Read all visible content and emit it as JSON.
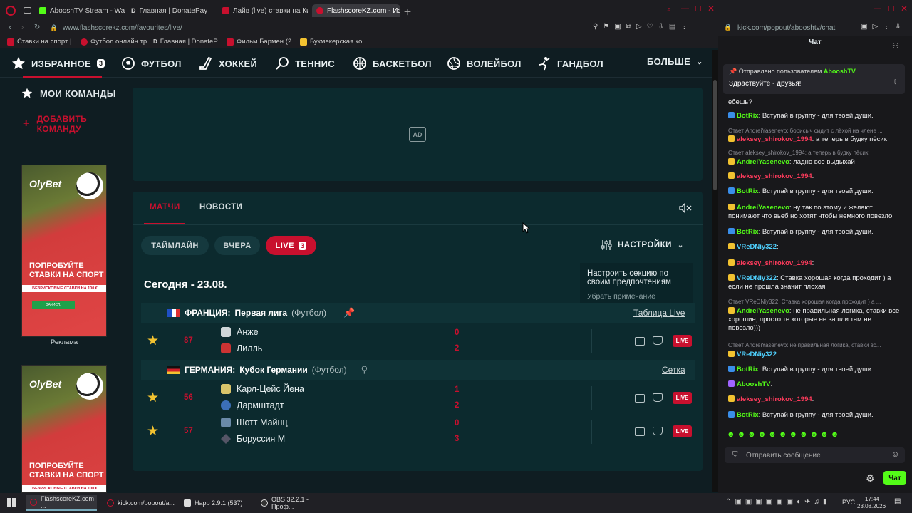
{
  "browser_tabs": [
    "AbooshTV Stream - Watch",
    "Главная | DonatePay",
    "Лайв (live) ставки на Киб",
    "FlashscoreKZ.com - Избра"
  ],
  "address": "www.flashscorekz.com/favourites/live/",
  "bookmarks": [
    "Ставки на спорт |...",
    "Футбол онлайн тр...",
    "Главная | DonateP...",
    "Фильм Бармен (2...",
    "Букмекерская ко..."
  ],
  "nav": {
    "favorites": "ИЗБРАННОЕ",
    "favorites_count": "3",
    "items": [
      "ФУТБОЛ",
      "ХОККЕЙ",
      "ТЕННИС",
      "БАСКЕТБОЛ",
      "ВОЛЕЙБОЛ",
      "ГАНДБОЛ"
    ],
    "more": "БОЛЬШЕ"
  },
  "sidebar": {
    "my_teams": "МОИ КОМАНДЫ",
    "add_team": [
      "ДОБАВИТЬ",
      "КОМАНДУ"
    ],
    "ad_label": "Реклама",
    "ad": {
      "brand": "OlyBet",
      "line1": "ПОПРОБУЙТЕ",
      "line2": "СТАВКИ НА СПОРТ",
      "sub": "БЕЗРИСКОВЫЕ СТАВКИ НА 100 €",
      "btn": "ЗАЧИСЛ."
    }
  },
  "ad_badge": "AD",
  "tabs": {
    "matches": "МАТЧИ",
    "news": "НОВОСТИ"
  },
  "filters": {
    "timeline": "ТАЙМЛАЙН",
    "yesterday": "ВЧЕРА",
    "live": "LIVE",
    "live_count": "3"
  },
  "settings": "НАСТРОЙКИ",
  "tooltip": {
    "text": "Настроить секцию по своим предпочтениям",
    "dismiss": "Убрать примечание"
  },
  "date_heading": "Сегодня - 23.08.",
  "leagues": [
    {
      "country": "ФРАНЦИЯ:",
      "name": "Первая лига",
      "sport": "(Футбол)",
      "link": "Таблица Live"
    },
    {
      "country": "ГЕРМАНИЯ:",
      "name": "Кубок Германии",
      "sport": "(Футбол)",
      "link": "Сетка"
    }
  ],
  "matches": [
    {
      "minute": "87",
      "home": "Анже",
      "away": "Лилль",
      "home_score": "0",
      "away_score": "2"
    },
    {
      "minute": "56",
      "home": "Карл-Цейс Йена",
      "away": "Дармштадт",
      "home_score": "1",
      "away_score": "2"
    },
    {
      "minute": "57",
      "home": "Шотт Майнц",
      "away": "Боруссия М",
      "home_score": "0",
      "away_score": "3"
    }
  ],
  "live_label": "LIVE",
  "chat": {
    "address": "kick.com/popout/abooshtv/chat",
    "title": "Чат",
    "pinned_by": "Отправлено пользователем",
    "pinned_user": "AbooshTV",
    "pinned_text": "Здраствуйте - друзья!",
    "messages": [
      {
        "type": "msg",
        "user": "",
        "text": "ебешь?"
      },
      {
        "type": "msg",
        "user": "BotRix",
        "text": ": Вступай в группу - для твоей души."
      },
      {
        "type": "reply",
        "text": "Ответ AndreiYasenevo: борисыч сидит с лёхой на члене ..."
      },
      {
        "type": "msg",
        "user": "aleksey_shirokov_1994",
        "text": ": а теперь в будку пёсик"
      },
      {
        "type": "reply",
        "text": "Ответ aleksey_shirokov_1994: а теперь в будку пёсик"
      },
      {
        "type": "msg",
        "user": "AndreiYasenevo",
        "text": ": ладно все выдыхай"
      },
      {
        "type": "msg",
        "user": "aleksey_shirokov_1994",
        "text": ":"
      },
      {
        "type": "msg",
        "user": "BotRix",
        "text": ": Вступай в группу - для твоей души."
      },
      {
        "type": "msg",
        "user": "AndreiYasenevo",
        "text": ": ну так по этому и желают понимают что вьеб но хотят чтобы немного повезло"
      },
      {
        "type": "msg",
        "user": "BotRix",
        "text": ": Вступай в группу - для твоей души."
      },
      {
        "type": "msg",
        "user": "VReDNiy322",
        "text": ":"
      },
      {
        "type": "msg",
        "user": "aleksey_shirokov_1994",
        "text": ":"
      },
      {
        "type": "msg",
        "user": "VReDNiy322",
        "text": ": Ставка хорошая когда проходит ) а если не прошла значит плохая"
      },
      {
        "type": "reply",
        "text": "Ответ VReDNiy322: Ставка хорошая когда проходит ) а ..."
      },
      {
        "type": "msg",
        "user": "AndreiYasenevo",
        "text": ": не правильная логика, ставки все хорошие, просто те которые не зашли там не повезло)))"
      },
      {
        "type": "reply",
        "text": "Ответ AndreiYasenevo: не правильная логика, ставки вс..."
      },
      {
        "type": "msg",
        "user": "VReDNiy322",
        "text": ":"
      },
      {
        "type": "msg",
        "user": "BotRix",
        "text": ": Вступай в группу - для твоей души."
      },
      {
        "type": "msg",
        "user": "AbooshTV",
        "text": ":"
      },
      {
        "type": "msg",
        "user": "aleksey_shirokov_1994",
        "text": ":"
      },
      {
        "type": "msg",
        "user": "BotRix",
        "text": ": Вступай в группу - для твоей души."
      }
    ],
    "input_placeholder": "Отправить сообщение",
    "send_button": "Чат"
  },
  "taskbar": {
    "items": [
      "FlashscoreKZ.com ...",
      "kick.com/popout/a...",
      "Happ 2.9.1 (537)",
      "OBS 32.2.1 - Проф..."
    ],
    "lang": "РУС",
    "time": "17:44",
    "date": "23.08.2026"
  },
  "colors": {
    "accent": "#c8102e",
    "panel": "#0c2a2e",
    "kick_green": "#53fc18"
  }
}
